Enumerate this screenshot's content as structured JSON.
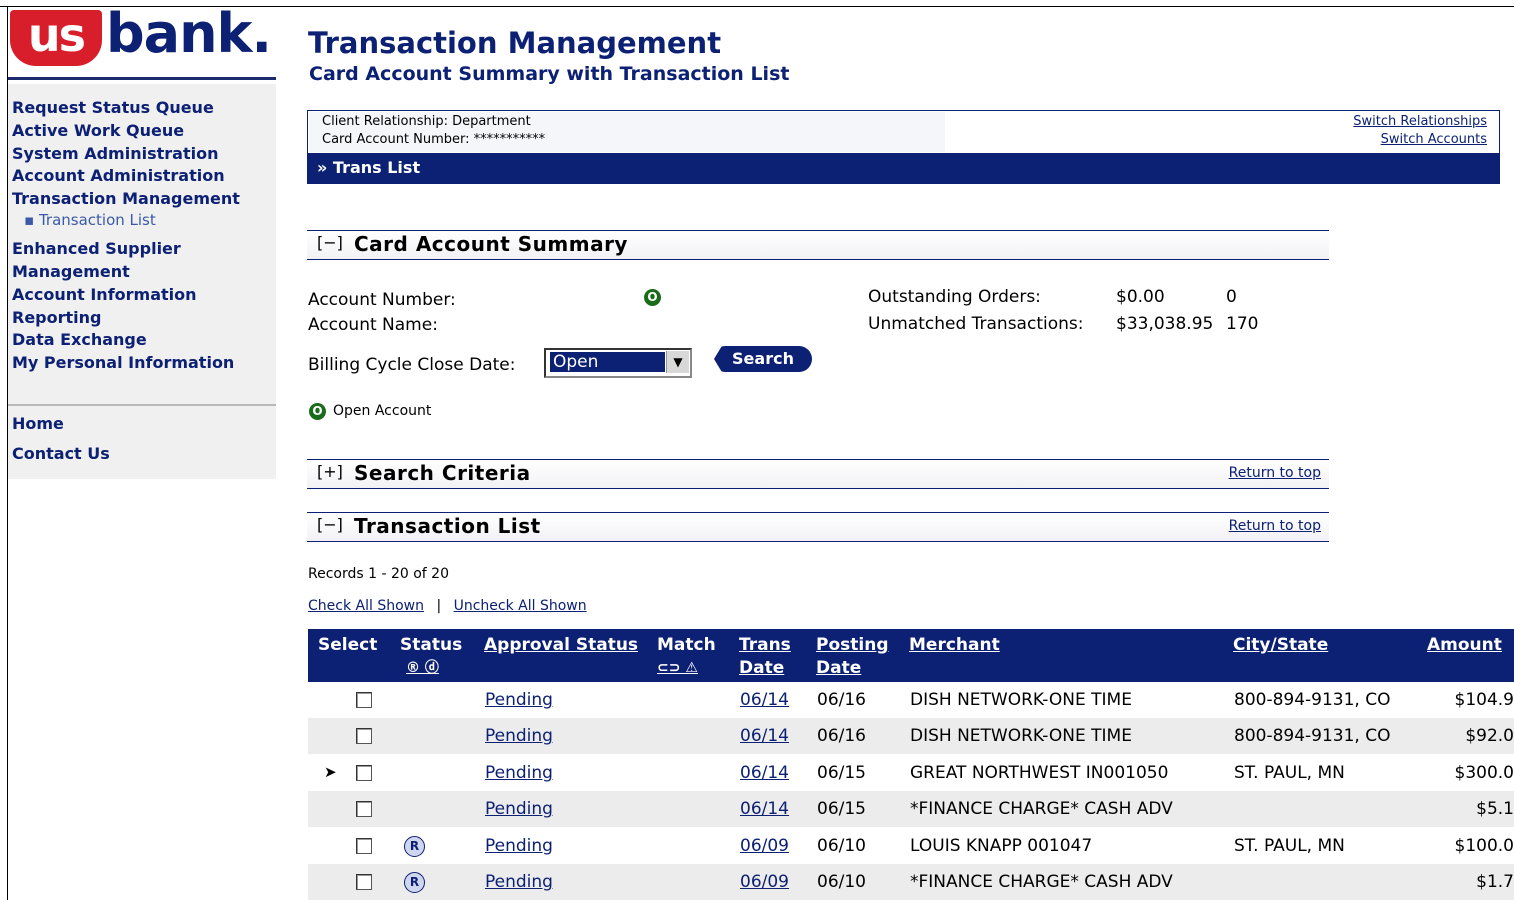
{
  "brand": {
    "logo_left": "us",
    "logo_right": "bank",
    "logo_dot": "."
  },
  "colors": {
    "brand_navy": "#0c2074",
    "brand_red": "#d81e2a",
    "status_green": "#1a6b1a"
  },
  "nav": {
    "items": [
      "Request Status Queue",
      "Active Work Queue",
      "System Administration",
      "Account Administration",
      "Transaction Management"
    ],
    "sub_item": "Transaction List",
    "items2": [
      "Enhanced Supplier",
      "Management",
      "Account Information",
      "Reporting",
      "Data Exchange",
      "My Personal Information"
    ],
    "home": "Home",
    "contact": "Contact Us"
  },
  "header": {
    "title": "Transaction Management",
    "subtitle": "Card Account Summary with Transaction List"
  },
  "info": {
    "client_relationship": "Client Relationship:  Department",
    "card_account_number": "Card Account Number:  ***********",
    "switch_relationships": "Switch Relationships",
    "switch_accounts": "Switch Accounts"
  },
  "breadcrumb": "» Trans List",
  "summary": {
    "toggle": "[−]",
    "title": "Card Account Summary",
    "account_number_label": "Account Number:",
    "account_name_label": "Account Name:",
    "outstanding_orders_label": "Outstanding Orders:",
    "outstanding_orders_amount": "$0.00",
    "outstanding_orders_count": "0",
    "unmatched_label": "Unmatched Transactions:",
    "unmatched_amount": "$33,038.95",
    "unmatched_count": "170",
    "billing_label": "Billing Cycle Close Date:",
    "billing_value": "Open",
    "search_button": "Search",
    "legend_open": "Open Account",
    "status_glyph": "O"
  },
  "search_criteria": {
    "toggle": "[+]",
    "title": "Search Criteria",
    "return_top": "Return to top"
  },
  "transaction_list": {
    "toggle": "[−]",
    "title": "Transaction List",
    "return_top": "Return to top",
    "records": "Records 1 - 20 of 20",
    "check_all": "Check All Shown",
    "separator": "|",
    "uncheck_all": "Uncheck All Shown",
    "columns": {
      "select": "Select",
      "status": "Status",
      "status_icons": "® ⓓ",
      "approval": "Approval Status",
      "match": "Match",
      "match_icons": "⊂⊃ ⚠",
      "trans": "Trans",
      "trans2": "Date",
      "posting": "Posting",
      "posting2": "Date",
      "merchant": "Merchant",
      "city": "City/State",
      "amount": "Amount"
    },
    "rows": [
      {
        "approval": "Pending",
        "trans": "06/14",
        "posting": "06/16",
        "merchant": "DISH NETWORK-ONE TIME",
        "city": "800-894-9131, CO",
        "amount": "$104.9",
        "badge": "",
        "pointer": ""
      },
      {
        "approval": "Pending",
        "trans": "06/14",
        "posting": "06/16",
        "merchant": "DISH NETWORK-ONE TIME",
        "city": "800-894-9131, CO",
        "amount": "$92.0",
        "badge": "",
        "pointer": ""
      },
      {
        "approval": "Pending",
        "trans": "06/14",
        "posting": "06/15",
        "merchant": "GREAT NORTHWEST IN001050",
        "city": "ST. PAUL, MN",
        "amount": "$300.0",
        "badge": "",
        "pointer": "➤"
      },
      {
        "approval": "Pending",
        "trans": "06/14",
        "posting": "06/15",
        "merchant": "*FINANCE CHARGE* CASH ADV",
        "city": "",
        "amount": "$5.1",
        "badge": "",
        "pointer": ""
      },
      {
        "approval": "Pending",
        "trans": "06/09",
        "posting": "06/10",
        "merchant": "LOUIS KNAPP 001047",
        "city": "ST. PAUL, MN",
        "amount": "$100.0",
        "badge": "R",
        "pointer": ""
      },
      {
        "approval": "Pending",
        "trans": "06/09",
        "posting": "06/10",
        "merchant": "*FINANCE CHARGE* CASH ADV",
        "city": "",
        "amount": "$1.7",
        "badge": "R",
        "pointer": ""
      }
    ]
  }
}
